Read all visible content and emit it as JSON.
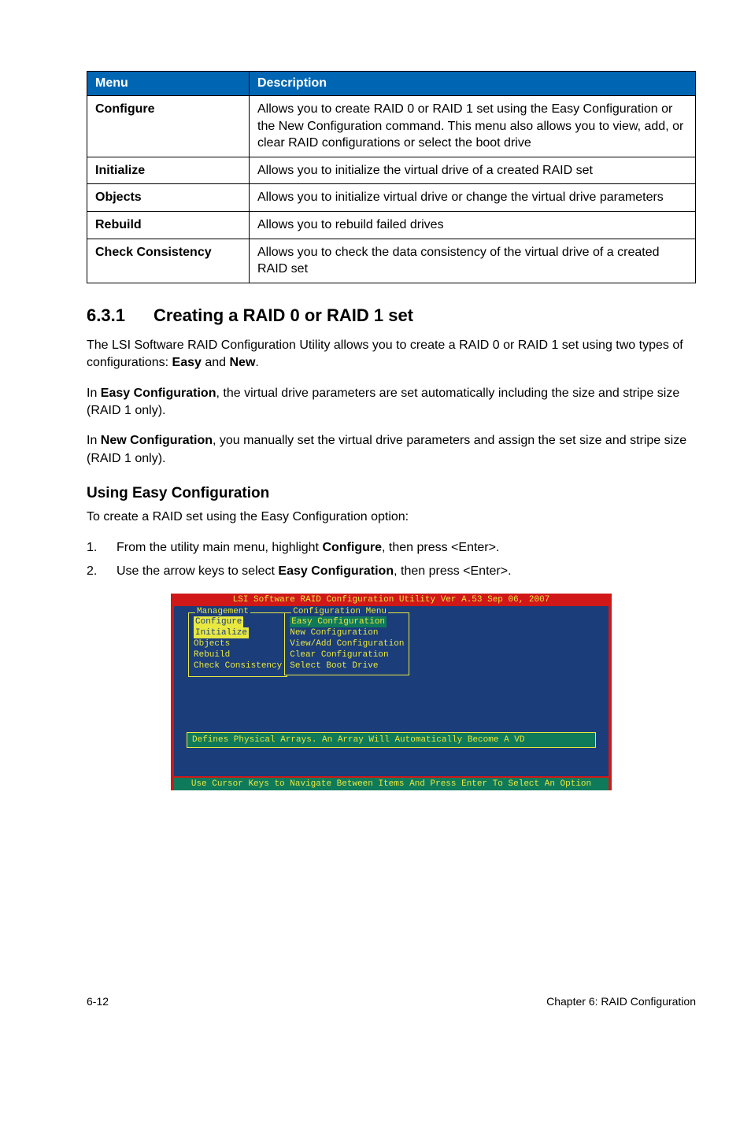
{
  "table": {
    "headers": {
      "menu": "Menu",
      "description": "Description"
    },
    "rows": [
      {
        "menu": "Configure",
        "description": "Allows you to create RAID 0 or RAID 1 set using the Easy Configuration or the New Configuration command. This menu also allows you to view, add, or clear RAID configurations or select the boot drive"
      },
      {
        "menu": "Initialize",
        "description": "Allows you to initialize the virtual drive of a created RAID set"
      },
      {
        "menu": "Objects",
        "description": "Allows you to initialize virtual drive or change the virtual drive parameters"
      },
      {
        "menu": "Rebuild",
        "description": "Allows you to rebuild failed drives"
      },
      {
        "menu": "Check Consistency",
        "description": "Allows you to check the data consistency of the virtual drive of a created RAID set"
      }
    ]
  },
  "section": {
    "number": "6.3.1",
    "title": "Creating a RAID 0 or RAID 1 set"
  },
  "paragraphs": {
    "p1_a": "The LSI Software RAID Configuration Utility allows you to create a RAID 0 or RAID 1 set using two types of configurations: ",
    "p1_easy": "Easy",
    "p1_and": " and ",
    "p1_new": "New",
    "p1_end": ".",
    "p2_a": "In ",
    "p2_b": "Easy Configuration",
    "p2_c": ", the virtual drive parameters are set automatically including the size and stripe size (RAID 1 only).",
    "p3_a": "In ",
    "p3_b": "New Configuration",
    "p3_c": ", you manually set the virtual drive parameters and assign the set size and stripe size (RAID 1 only)."
  },
  "subsection_title": "Using Easy Configuration",
  "subsection_intro": "To create a RAID set using the Easy Configuration option:",
  "steps": [
    {
      "num": "1.",
      "pre": "From the utility main menu, highlight ",
      "bold": "Configure",
      "post": ", then press <Enter>."
    },
    {
      "num": "2.",
      "pre": "Use the arrow keys to select ",
      "bold": "Easy Configuration",
      "post": ", then press <Enter>."
    }
  ],
  "screenshot": {
    "title": "LSI Software RAID Configuration Utility Ver A.53 Sep 06, 2007",
    "mgmt_title": "Management",
    "mgmt_items": [
      "Configure",
      "Initialize",
      "Objects",
      "Rebuild",
      "Check Consistency"
    ],
    "conf_title": "Configuration Menu",
    "conf_items": [
      "Easy Configuration",
      "New Configuration",
      "View/Add Configuration",
      "Clear Configuration",
      "Select Boot Drive"
    ],
    "status": "Defines Physical Arrays. An Array Will Automatically Become A VD",
    "footer": "Use Cursor Keys to Navigate Between Items And Press Enter To Select An Option"
  },
  "page_footer": {
    "left": "6-12",
    "right": "Chapter 6: RAID Configuration"
  }
}
